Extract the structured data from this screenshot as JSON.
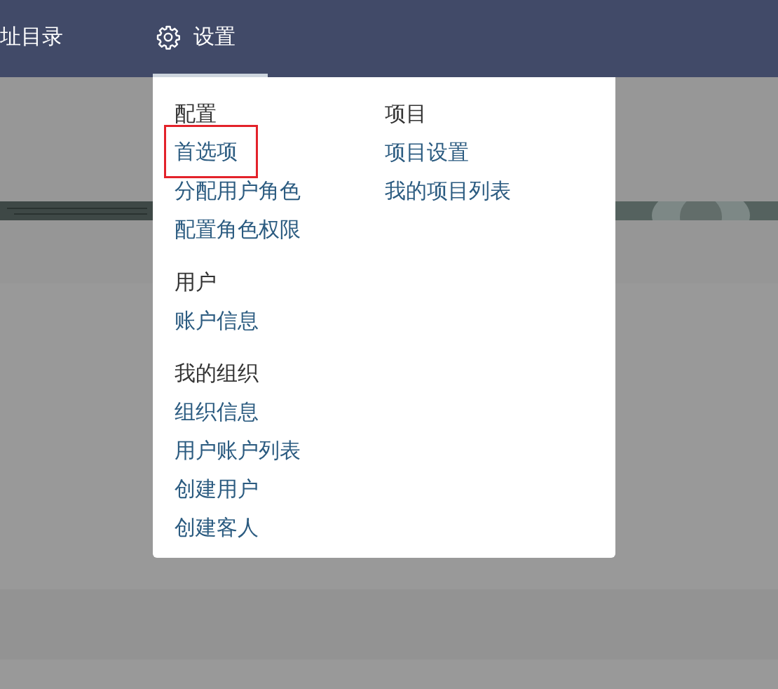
{
  "nav": [
    {
      "label": "址目录",
      "kind": "text",
      "selected": false
    },
    {
      "label": "设置",
      "kind": "gear",
      "selected": true
    }
  ],
  "menu": {
    "columns": [
      {
        "groups": [
          {
            "heading": "配置",
            "items": [
              {
                "label": "首选项",
                "highlighted": true
              },
              {
                "label": "分配用户角色",
                "highlighted": false
              },
              {
                "label": "配置角色权限",
                "highlighted": false
              }
            ]
          },
          {
            "heading": "用户",
            "items": [
              {
                "label": "账户信息",
                "highlighted": false
              }
            ]
          },
          {
            "heading": "我的组织",
            "items": [
              {
                "label": "组织信息",
                "highlighted": false
              },
              {
                "label": "用户账户列表",
                "highlighted": false
              },
              {
                "label": "创建用户",
                "highlighted": false
              },
              {
                "label": "创建客人",
                "highlighted": false
              }
            ]
          }
        ]
      },
      {
        "groups": [
          {
            "heading": "项目",
            "items": [
              {
                "label": "项目设置",
                "highlighted": false
              },
              {
                "label": "我的项目列表",
                "highlighted": false
              }
            ]
          }
        ]
      }
    ]
  }
}
